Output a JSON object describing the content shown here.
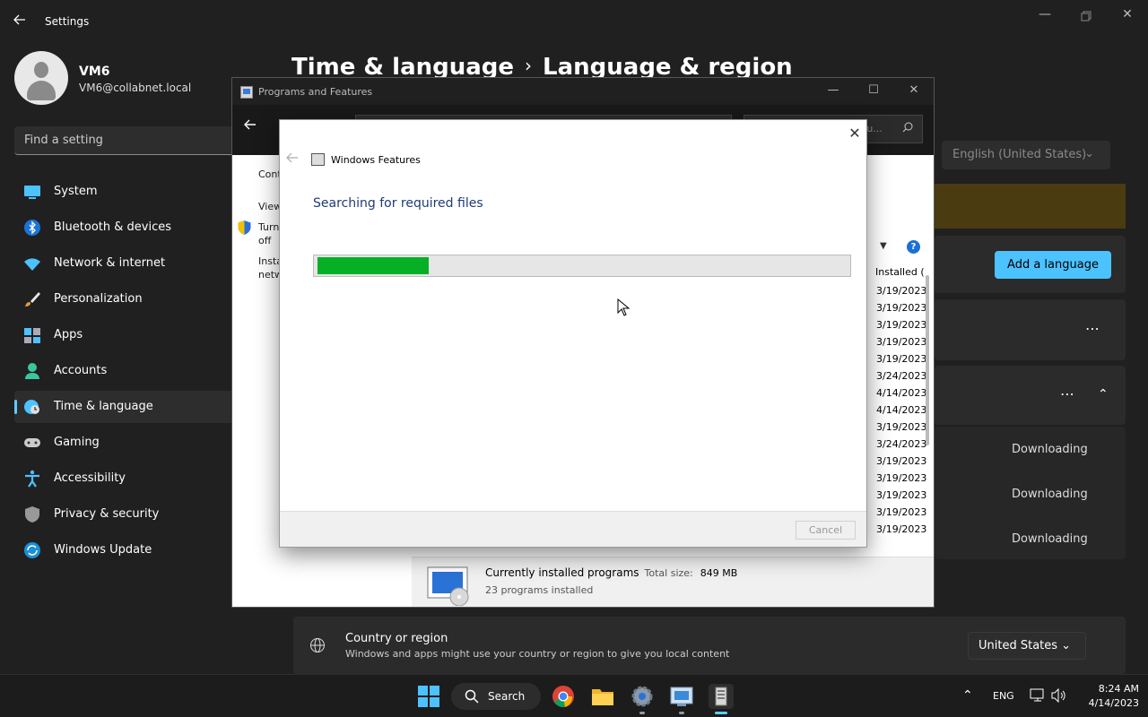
{
  "settings": {
    "app_title": "Settings",
    "user": {
      "name": "VM6",
      "email": "VM6@collabnet.local"
    },
    "search_placeholder": "Find a setting",
    "nav": [
      {
        "label": "System",
        "icon": "monitor-icon"
      },
      {
        "label": "Bluetooth & devices",
        "icon": "bluetooth-icon"
      },
      {
        "label": "Network & internet",
        "icon": "wifi-icon"
      },
      {
        "label": "Personalization",
        "icon": "brush-icon"
      },
      {
        "label": "Apps",
        "icon": "apps-icon"
      },
      {
        "label": "Accounts",
        "icon": "person-icon"
      },
      {
        "label": "Time & language",
        "icon": "globe-clock-icon",
        "active": true
      },
      {
        "label": "Gaming",
        "icon": "gamepad-icon"
      },
      {
        "label": "Accessibility",
        "icon": "accessibility-icon"
      },
      {
        "label": "Privacy & security",
        "icon": "shield-icon"
      },
      {
        "label": "Windows Update",
        "icon": "update-icon"
      }
    ],
    "breadcrumb": {
      "parent": "Time & language",
      "separator": "›",
      "current": "Language & region"
    },
    "preferred_language": "English (United States)",
    "add_language_label": "Add a language",
    "downloading": [
      "Downloading",
      "Downloading",
      "Downloading"
    ],
    "country": {
      "title": "Country or region",
      "description": "Windows and apps might use your country or region to give you local content",
      "value": "United States"
    },
    "accent_color": "#4cc2ff"
  },
  "programs_features": {
    "title": "Programs and Features",
    "search_fragment": "tu...",
    "side_links": [
      "Cont",
      "View",
      "Turn",
      "off",
      "Insta",
      "netw"
    ],
    "column_header": "Installed (",
    "dates": [
      "3/19/2023",
      "3/19/2023",
      "3/19/2023",
      "3/19/2023",
      "3/19/2023",
      "3/24/2023",
      "4/14/2023",
      "4/14/2023",
      "3/19/2023",
      "3/24/2023",
      "3/19/2023",
      "3/19/2023",
      "3/19/2023",
      "3/19/2023",
      "3/19/2023"
    ],
    "status": {
      "title": "Currently installed programs",
      "size_label": "Total size:",
      "size_value": "849 MB",
      "count": "23 programs installed"
    }
  },
  "windows_features": {
    "title": "Windows Features",
    "heading": "Searching for required files",
    "progress_percent": 21,
    "progress_color": "#06b025",
    "cancel_label": "Cancel"
  },
  "taskbar": {
    "search_label": "Search",
    "language": "ENG",
    "time": "8:24 AM",
    "date": "4/14/2023"
  }
}
